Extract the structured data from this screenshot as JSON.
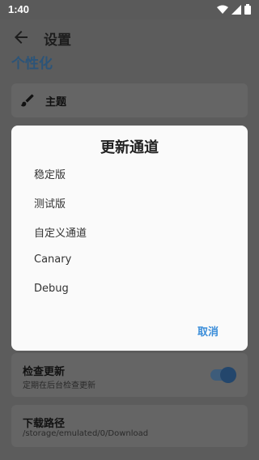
{
  "status_bar": {
    "time": "1:40",
    "icons": [
      "wifi-icon",
      "signal-icon",
      "battery-icon"
    ]
  },
  "app_bar": {
    "title": "设置",
    "back_icon": "arrow-left-icon"
  },
  "section": {
    "title": "个性化"
  },
  "theme_item": {
    "label": "主题",
    "icon": "brush-icon"
  },
  "check_update_item": {
    "title": "检查更新",
    "subtitle": "定期在后台检查更新",
    "toggle_on": true
  },
  "download_path_item": {
    "title": "下载路径",
    "value": "/storage/emulated/0/Download"
  },
  "dialog": {
    "title": "更新通道",
    "options": [
      {
        "label": "稳定版"
      },
      {
        "label": "测试版"
      },
      {
        "label": "自定义通道"
      },
      {
        "label": "Canary"
      },
      {
        "label": "Debug"
      }
    ],
    "cancel_label": "取消"
  },
  "colors": {
    "accent": "#3a8dd9",
    "scrim": "#5c5c5c",
    "toggle": "#23466c"
  }
}
